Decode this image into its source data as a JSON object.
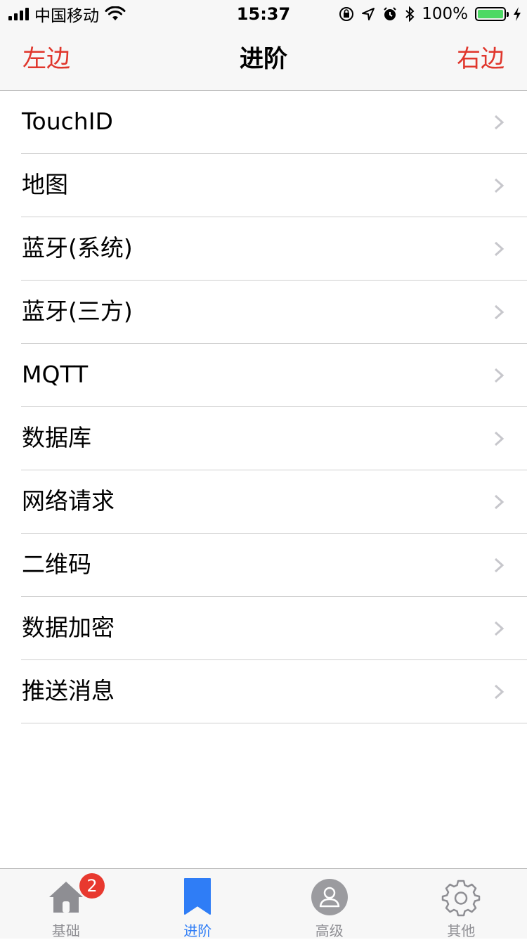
{
  "status_bar": {
    "carrier": "中国移动",
    "time": "15:37",
    "battery": "100%"
  },
  "nav": {
    "left": "左边",
    "title": "进阶",
    "right": "右边"
  },
  "list": {
    "items": [
      {
        "label": "TouchID"
      },
      {
        "label": "地图"
      },
      {
        "label": "蓝牙(系统)"
      },
      {
        "label": "蓝牙(三方)"
      },
      {
        "label": "MQTT"
      },
      {
        "label": "数据库"
      },
      {
        "label": "网络请求"
      },
      {
        "label": "二维码"
      },
      {
        "label": "数据加密"
      },
      {
        "label": "推送消息"
      }
    ]
  },
  "tab_bar": {
    "tabs": [
      {
        "label": "基础",
        "icon": "home-icon",
        "badge": "2"
      },
      {
        "label": "进阶",
        "icon": "bookmark-icon"
      },
      {
        "label": "高级",
        "icon": "user-icon"
      },
      {
        "label": "其他",
        "icon": "gear-icon"
      }
    ],
    "active_color": "#2f7df6",
    "inactive_color": "#8e8e93"
  },
  "colors": {
    "nav_accent": "#e0362c",
    "badge": "#e8392f",
    "battery": "#4cd964"
  }
}
